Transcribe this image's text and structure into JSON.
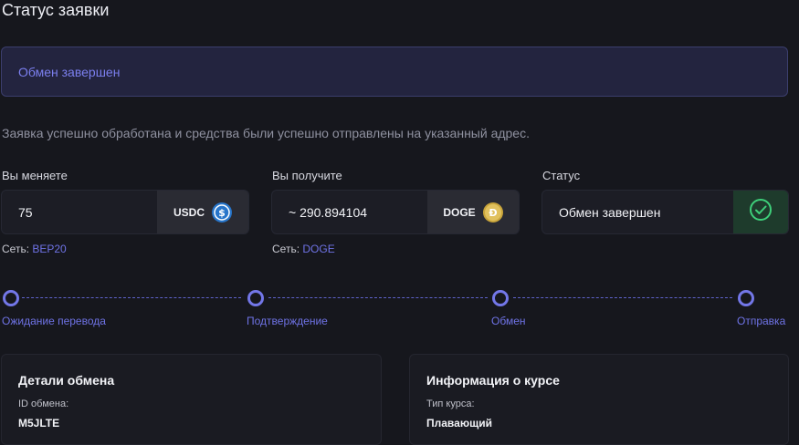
{
  "page": {
    "title": "Статус заявки"
  },
  "banner": {
    "text": "Обмен завершен"
  },
  "description": "Заявка успешно обработана и средства были успешно отправлены на указанный адрес.",
  "send": {
    "label": "Вы меняете",
    "amount": "75",
    "currency": "USDC",
    "icon": "usdc-coin-icon",
    "network_label": "Сеть:",
    "network": "BEP20"
  },
  "receive": {
    "label": "Вы получите",
    "amount": "~ 290.894104",
    "currency": "DOGE",
    "icon": "doge-coin-icon",
    "network_label": "Сеть:",
    "network": "DOGE"
  },
  "status": {
    "label": "Статус",
    "value": "Обмен завершен",
    "icon": "check-circle-icon"
  },
  "steps": [
    {
      "label": "Ожидание перевода"
    },
    {
      "label": "Подтверждение"
    },
    {
      "label": "Обмен"
    },
    {
      "label": "Отправка"
    }
  ],
  "details": {
    "title": "Детали обмена",
    "id_label": "ID обмена:",
    "id_value": "M5JLTE"
  },
  "rate": {
    "title": "Информация о курсе",
    "type_label": "Тип курса:",
    "type_value": "Плавающий"
  },
  "colors": {
    "accent": "#7377e8",
    "success": "#3ecf7a",
    "background": "#16171d"
  }
}
